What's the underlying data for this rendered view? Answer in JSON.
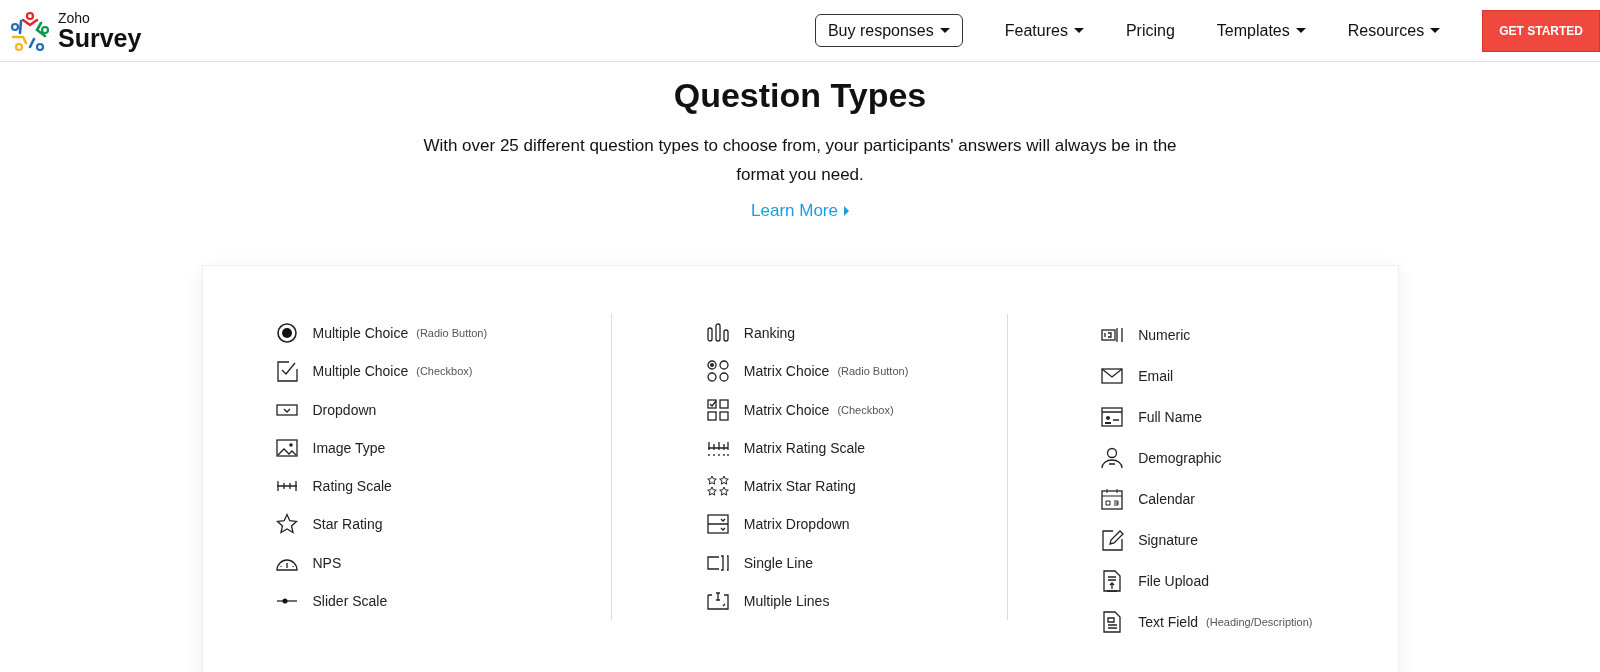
{
  "header": {
    "logo": {
      "line_1": "Zoho",
      "line_2": "Survey"
    },
    "nav": [
      {
        "label": "Buy responses",
        "kind": "outlined",
        "has_menu": true
      },
      {
        "label": "Features",
        "kind": "plain",
        "has_menu": true
      },
      {
        "label": "Pricing",
        "kind": "plain",
        "has_menu": false
      },
      {
        "label": "Templates",
        "kind": "plain",
        "has_menu": true
      },
      {
        "label": "Resources",
        "kind": "plain",
        "has_menu": true
      },
      {
        "label": "GET STARTED",
        "kind": "cta",
        "has_menu": false
      }
    ]
  },
  "intro": {
    "title": "Question Types",
    "text": "With over 25 different question types to choose from, your participants' answers will always be in the format you need.",
    "link": "Learn More"
  },
  "columns": [
    {
      "items": [
        {
          "kind": "radio",
          "label": "Multiple Choice",
          "note": "(Radio Button)"
        },
        {
          "kind": "checkbox",
          "label": "Multiple Choice",
          "note": "(Checkbox)"
        },
        {
          "kind": "dropdown",
          "label": "Dropdown"
        },
        {
          "kind": "image",
          "label": "Image Type"
        },
        {
          "kind": "rating-scale",
          "label": "Rating Scale"
        },
        {
          "kind": "star",
          "label": "Star Rating"
        },
        {
          "kind": "nps",
          "label": "NPS"
        },
        {
          "kind": "slider",
          "label": "Slider Scale"
        }
      ]
    },
    {
      "items": [
        {
          "kind": "ranking",
          "label": "Ranking"
        },
        {
          "kind": "matrix-radio",
          "label": "Matrix Choice",
          "note": "(Radio Button)"
        },
        {
          "kind": "matrix-checkbox",
          "label": "Matrix Choice",
          "note": "(Checkbox)"
        },
        {
          "kind": "matrix-rating",
          "label": "Matrix Rating Scale"
        },
        {
          "kind": "matrix-star",
          "label": "Matrix Star Rating"
        },
        {
          "kind": "matrix-dropdown",
          "label": "Matrix Dropdown"
        },
        {
          "kind": "single-line",
          "label": "Single Line"
        },
        {
          "kind": "multi-line",
          "label": "Multiple Lines"
        }
      ]
    },
    {
      "items": [
        {
          "kind": "numeric",
          "label": "Numeric"
        },
        {
          "kind": "email",
          "label": "Email"
        },
        {
          "kind": "full-name",
          "label": "Full Name"
        },
        {
          "kind": "person",
          "label": "Demographic"
        },
        {
          "kind": "calendar",
          "label": "Calendar"
        },
        {
          "kind": "signature",
          "label": "Signature"
        },
        {
          "kind": "file-upload",
          "label": "File Upload"
        },
        {
          "kind": "text-field",
          "label": "Text Field",
          "note": "(Heading/Description)"
        }
      ]
    }
  ]
}
